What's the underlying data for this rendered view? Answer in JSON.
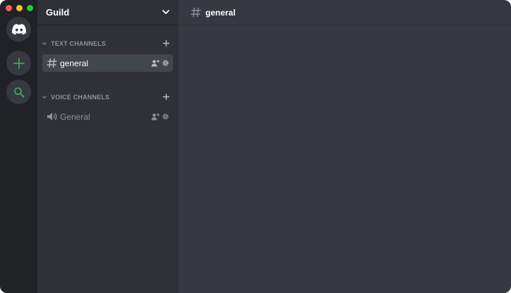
{
  "window": {
    "controls": [
      "close",
      "minimize",
      "zoom"
    ]
  },
  "rail": {
    "home_icon": "discord-logo-icon",
    "add_icon": "plus-icon",
    "search_icon": "search-icon",
    "accent_color": "#3ba55c"
  },
  "guild": {
    "name": "Guild",
    "chevron_icon": "chevron-down-icon"
  },
  "categories": [
    {
      "label": "TEXT CHANNELS",
      "channels": [
        {
          "name": "general",
          "type": "text",
          "selected": true
        }
      ]
    },
    {
      "label": "VOICE CHANNELS",
      "channels": [
        {
          "name": "General",
          "type": "voice",
          "selected": false
        }
      ]
    }
  ],
  "main": {
    "channel_name": "general",
    "hash_icon": "hash-icon"
  }
}
